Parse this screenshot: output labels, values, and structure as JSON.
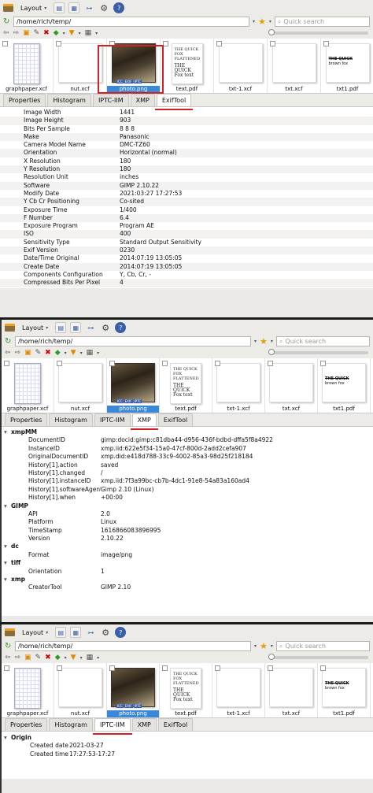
{
  "toolbar": {
    "layout_label": "Layout"
  },
  "address": {
    "path": "/home/rich/temp/",
    "search_placeholder": "Quick search"
  },
  "files": [
    "graphpaper.xcf",
    "nut.xcf",
    "photo.png",
    "text.pdf",
    "txt-1.xcf",
    "txt.xcf",
    "txt1.pdf"
  ],
  "thumb_text": {
    "doc_small": "THE QUICK FOX FLATTENED",
    "doc_big": "THE QUICK Fox text",
    "txt1_text": "brown fox",
    "txt1_strike": "THE QUICK"
  },
  "badges": [
    "ICC",
    "EXIF",
    "IPTC"
  ],
  "tabs": [
    "Properties",
    "Histogram",
    "IPTC-IIM",
    "XMP",
    "ExifTool"
  ],
  "exif": [
    {
      "k": "Image Width",
      "v": "1441"
    },
    {
      "k": "Image Height",
      "v": "903"
    },
    {
      "k": "Bits Per Sample",
      "v": "8 8 8"
    },
    {
      "k": "Make",
      "v": "Panasonic"
    },
    {
      "k": "Camera Model Name",
      "v": "DMC-TZ60"
    },
    {
      "k": "Orientation",
      "v": "Horizontal (normal)"
    },
    {
      "k": "X Resolution",
      "v": "180"
    },
    {
      "k": "Y Resolution",
      "v": "180"
    },
    {
      "k": "Resolution Unit",
      "v": "inches"
    },
    {
      "k": "Software",
      "v": "GIMP 2.10.22"
    },
    {
      "k": "Modify Date",
      "v": "2021:03:27 17:27:53"
    },
    {
      "k": "Y Cb Cr Positioning",
      "v": "Co-sited"
    },
    {
      "k": "Exposure Time",
      "v": "1/400"
    },
    {
      "k": "F Number",
      "v": "6.4"
    },
    {
      "k": "Exposure Program",
      "v": "Program AE"
    },
    {
      "k": "ISO",
      "v": "400"
    },
    {
      "k": "Sensitivity Type",
      "v": "Standard Output Sensitivity"
    },
    {
      "k": "Exif Version",
      "v": "0230"
    },
    {
      "k": "Date/Time Original",
      "v": "2014:07:19 13:05:05"
    },
    {
      "k": "Create Date",
      "v": "2014:07:19 13:05:05"
    },
    {
      "k": "Components Configuration",
      "v": "Y, Cb, Cr, -"
    },
    {
      "k": "Compressed Bits Per Pixel",
      "v": "4"
    }
  ],
  "xmp": [
    {
      "group": "xmpMM",
      "rows": [
        {
          "k": "DocumentID",
          "v": "gimp:docid:gimp:c81dba44-d956-436f-bdbd-dffa5f8a4922"
        },
        {
          "k": "InstanceID",
          "v": "xmp.iid:622e5f34-15a0-47cf-800d-2add2cefa907"
        },
        {
          "k": "OriginalDocumentID",
          "v": "xmp.did:e418d788-33c9-4002-85a3-98d25f218184"
        },
        {
          "k": "History[1].action",
          "v": "saved"
        },
        {
          "k": "History[1].changed",
          "v": "/"
        },
        {
          "k": "History[1].instanceID",
          "v": "xmp.iid:7f3a99bc-cb7b-4dc1-91e8-54a83a160ad4"
        },
        {
          "k": "History[1].softwareAgent",
          "v": "Gimp 2.10 (Linux)"
        },
        {
          "k": "History[1].when",
          "v": "+00:00"
        }
      ]
    },
    {
      "group": "GIMP",
      "rows": [
        {
          "k": "API",
          "v": "2.0"
        },
        {
          "k": "Platform",
          "v": "Linux"
        },
        {
          "k": "TimeStamp",
          "v": "1616866083896995"
        },
        {
          "k": "Version",
          "v": "2.10.22"
        }
      ]
    },
    {
      "group": "dc",
      "rows": [
        {
          "k": "Format",
          "v": "image/png"
        }
      ]
    },
    {
      "group": "tiff",
      "rows": [
        {
          "k": "Orientation",
          "v": "1"
        }
      ]
    },
    {
      "group": "xmp",
      "rows": [
        {
          "k": "CreatorTool",
          "v": "GIMP 2.10"
        }
      ]
    }
  ],
  "iptc": {
    "group": "Origin",
    "rows": [
      {
        "k": "Created date",
        "v": "2021-03-27"
      },
      {
        "k": "Created time",
        "v": "17:27:53-17:27"
      }
    ]
  },
  "colors": {
    "accent": "#d42020",
    "selection": "#3a88d8"
  }
}
